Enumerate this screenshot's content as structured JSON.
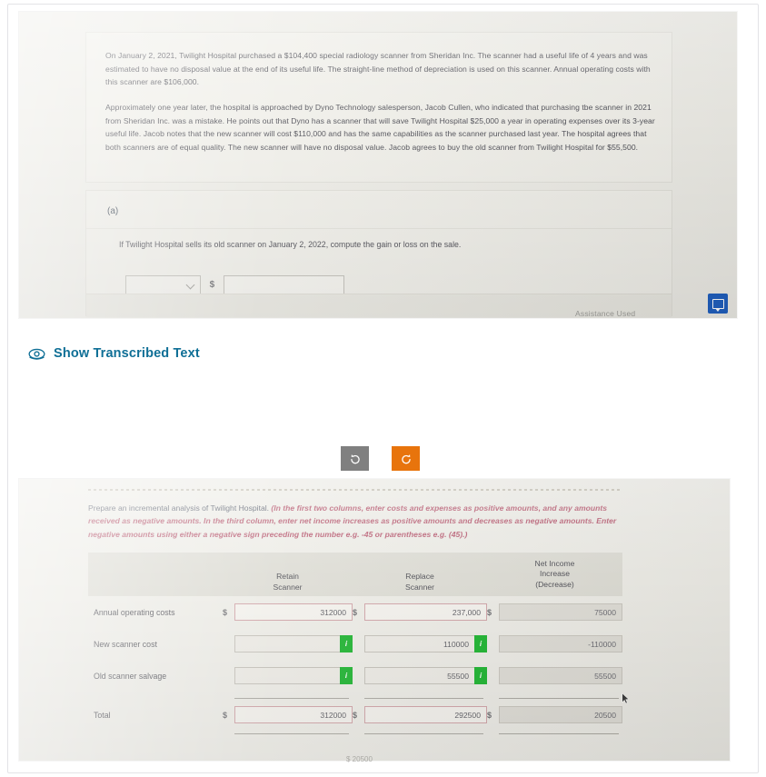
{
  "photo_one": {
    "scenario_paragraph_1": "On January 2, 2021, Twilight Hospital purchased a $104,400 special radiology scanner from Sheridan Inc. The scanner had a useful life of 4 years and was estimated to have no disposal value at the end of its useful life. The straight-line method of depreciation is used on this scanner. Annual operating costs with this scanner are $106,000.",
    "scenario_paragraph_2": "Approximately one year later, the hospital is approached by Dyno Technology salesperson, Jacob Cullen, who indicated that purchasing tbe scanner in 2021 from Sheridan Inc. was a mistake. He points out that Dyno has a scanner that will save Twilight Hospital $25,000 a year in operating expenses over its 3-year useful life. Jacob notes that the new scanner will cost $110,000 and has the same capabilities as the scanner purchased last year. The hospital agrees that both scanners are of equal quality. The new scanner will have no disposal value. Jacob agrees to buy the old scanner from Twilight Hospital for $55,500.",
    "part_label": "(a)",
    "part_question": "If Twilight Hospital sells its old scanner on January 2, 2022, compute the gain or loss on the sale.",
    "answer_select_value": "",
    "answer_currency_symbol": "$",
    "answer_input_value": "",
    "assistance_label": "Assistance Used",
    "chat_icon": "chat-bubble-icon"
  },
  "transcribe": {
    "label": "Show Transcribed Text",
    "icon": "eye-icon",
    "color": "#0f6f96"
  },
  "rotate_controls": [
    {
      "name": "rotate-left-button",
      "icon": "rotate-counterclockwise-icon",
      "color": "#808080"
    },
    {
      "name": "rotate-right-button",
      "icon": "rotate-clockwise-icon",
      "color": "#e8740c"
    }
  ],
  "photo_two": {
    "instruction_lead": "Prepare an incremental analysis of Twilight Hospital. ",
    "instruction_emphasis": "(In the first two columns, enter costs and expenses as positive amounts, and any amounts received as negative amounts.  In the third column, enter net income increases as positive amounts and decreases as negative amounts. Enter negative amounts using either a negative sign preceding the number e.g. -45 or parentheses e.g. (45).)",
    "table": {
      "headers": {
        "label": "",
        "retain": [
          "Retain",
          "Scanner"
        ],
        "replace": [
          "Replace",
          "Scanner"
        ],
        "net_income": [
          "Net Income",
          "Increase",
          "(Decrease)"
        ]
      },
      "rows": [
        {
          "label": "Annual operating costs",
          "retain": {
            "currency": "$",
            "value": "312000",
            "state": "error"
          },
          "replace": {
            "currency": "$",
            "value": "237,000",
            "state": "error"
          },
          "net": {
            "currency": "$",
            "value": "75000",
            "state": "readonly"
          }
        },
        {
          "label": "New scanner cost",
          "retain": {
            "currency": "",
            "value": "",
            "state": "badge"
          },
          "replace": {
            "currency": "",
            "value": "110000",
            "state": "badge"
          },
          "net": {
            "currency": "",
            "value": "-110000",
            "state": "readonly"
          }
        },
        {
          "label": "Old scanner salvage",
          "retain": {
            "currency": "",
            "value": "",
            "state": "badge"
          },
          "replace": {
            "currency": "",
            "value": "55500",
            "state": "badge"
          },
          "net": {
            "currency": "",
            "value": "55500",
            "state": "readonly"
          }
        }
      ],
      "total_row": {
        "label": "Total",
        "retain": {
          "currency": "$",
          "value": "312000",
          "state": "error"
        },
        "replace": {
          "currency": "$",
          "value": "292500",
          "state": "error"
        },
        "net": {
          "currency": "$",
          "value": "20500",
          "state": "readonly"
        }
      },
      "badge_glyph": "i"
    },
    "cutoff_text": "$ 20500"
  }
}
